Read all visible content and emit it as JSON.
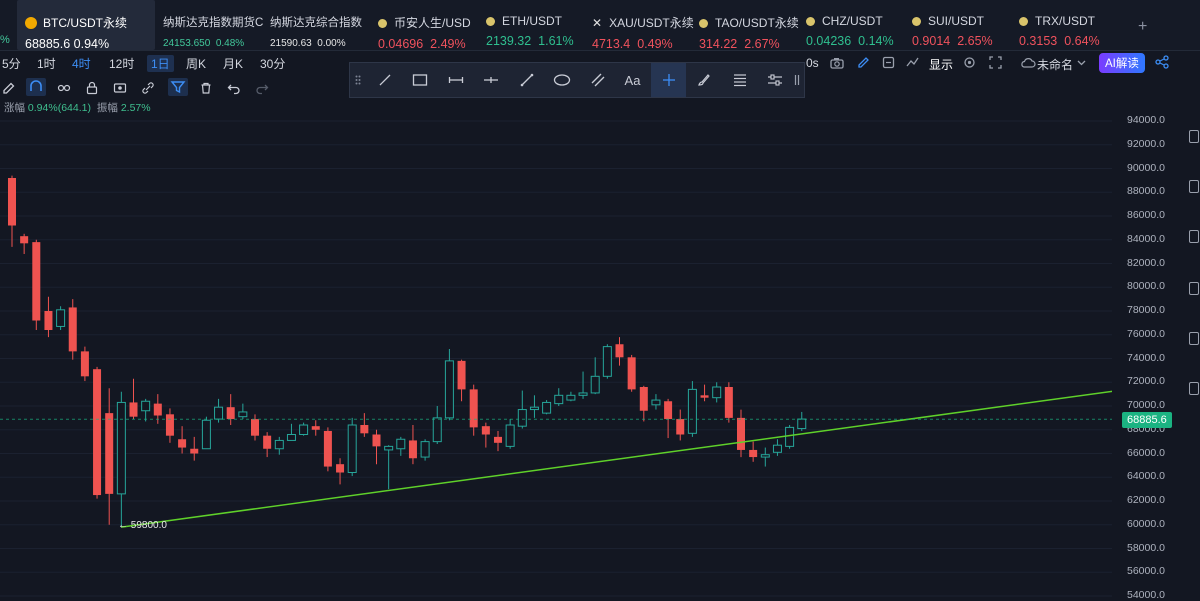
{
  "tickers": [
    {
      "name": "BTC/USDT永续",
      "price": "68885.6",
      "change": "0.94%",
      "color": "#ffffff"
    },
    {
      "name": "纳斯达克指数期货C",
      "price": "24153.650",
      "change": "0.48%",
      "color": "#42c89b"
    },
    {
      "name": "纳斯达克综合指数",
      "price": "21590.63",
      "change": "0.00%",
      "color": "#ffffff"
    },
    {
      "name": "币安人生/USD",
      "price": "0.04696",
      "change": "2.49%",
      "color": "#f0525d"
    },
    {
      "name": "ETH/USDT",
      "price": "2139.32",
      "change": "1.61%",
      "color": "#2fbf8f"
    },
    {
      "name": "XAU/USDT永续",
      "price": "4713.4",
      "change": "0.49%",
      "color": "#f0525d"
    },
    {
      "name": "TAO/USDT永续",
      "price": "314.22",
      "change": "2.67%",
      "color": "#f0525d"
    },
    {
      "name": "CHZ/USDT",
      "price": "0.04236",
      "change": "0.14%",
      "color": "#2fbf8f"
    },
    {
      "name": "SUI/USDT",
      "price": "0.9014",
      "change": "2.65%",
      "color": "#f0525d"
    },
    {
      "name": "TRX/USDT",
      "price": "0.3153",
      "change": "0.64%",
      "color": "#f0525d"
    }
  ],
  "left_edge_marker": "%",
  "add_symbol": "+",
  "intervals": [
    "5分",
    "1时",
    "4时",
    "12时",
    "1日",
    "周K",
    "月K",
    "30分"
  ],
  "active_interval": "4时",
  "selected_interval": "1日",
  "right_toolbar": {
    "interval_fragment": "0s",
    "display_label": "显示",
    "layout_name": "未命名",
    "ai_button": "AI解读"
  },
  "change_info": {
    "change_label": "涨幅",
    "change_value": "0.94%(644.1)",
    "amplitude_label": "振幅",
    "amplitude_value": "2.57%"
  },
  "draw_tools": [
    "cursor",
    "line",
    "rectangle",
    "horizontal-ray",
    "horizontal-line",
    "trend-line",
    "ellipse",
    "parallel-channel",
    "text",
    "crosshair",
    "brush",
    "fib",
    "settings"
  ],
  "price_axis": [
    "94000.0",
    "92000.0",
    "90000.0",
    "88000.0",
    "86000.0",
    "84000.0",
    "82000.0",
    "80000.0",
    "78000.0",
    "76000.0",
    "74000.0",
    "72000.0",
    "70000.0",
    "68000.0",
    "66000.0",
    "64000.0",
    "62000.0",
    "60000.0",
    "58000.0",
    "56000.0",
    "54000.0"
  ],
  "last_price": "68885.6",
  "low_label": "← 59800.0",
  "colors": {
    "up": "#26a69a",
    "down": "#ef5350",
    "trendline": "#5fd12a",
    "background": "#131722",
    "last_price_tag": "#1bb382"
  },
  "chart_data": {
    "type": "candlestick",
    "ylim": [
      54000,
      95500
    ],
    "last_price": 68885.6,
    "low": 59800.0,
    "trendline": {
      "from": 59800,
      "to": 71300
    },
    "candles": [
      {
        "o": 89200,
        "h": 89400,
        "c": 85200,
        "l": 83400
      },
      {
        "o": 84300,
        "h": 84500,
        "c": 83700,
        "l": 82800
      },
      {
        "o": 83800,
        "h": 84000,
        "c": 77200,
        "l": 76400
      },
      {
        "o": 78000,
        "h": 79200,
        "c": 76400,
        "l": 75800
      },
      {
        "o": 76700,
        "h": 78400,
        "c": 78100,
        "l": 76400
      },
      {
        "o": 78300,
        "h": 79000,
        "c": 74600,
        "l": 73900
      },
      {
        "o": 74600,
        "h": 75000,
        "c": 72500,
        "l": 72100
      },
      {
        "o": 73100,
        "h": 73300,
        "c": 62500,
        "l": 62200
      },
      {
        "o": 69400,
        "h": 71500,
        "c": 62600,
        "l": 60000
      },
      {
        "o": 62600,
        "h": 71200,
        "c": 70300,
        "l": 59800
      },
      {
        "o": 70300,
        "h": 72300,
        "c": 69100,
        "l": 68900
      },
      {
        "o": 69600,
        "h": 70600,
        "c": 70400,
        "l": 68700
      },
      {
        "o": 70200,
        "h": 71000,
        "c": 69200,
        "l": 68500
      },
      {
        "o": 69300,
        "h": 69800,
        "c": 67500,
        "l": 66900
      },
      {
        "o": 67200,
        "h": 68300,
        "c": 66500,
        "l": 66000
      },
      {
        "o": 66400,
        "h": 67400,
        "c": 66000,
        "l": 65400
      },
      {
        "o": 66400,
        "h": 69100,
        "c": 68800,
        "l": 66400
      },
      {
        "o": 68900,
        "h": 70600,
        "c": 69900,
        "l": 68600
      },
      {
        "o": 69900,
        "h": 71000,
        "c": 68900,
        "l": 68400
      },
      {
        "o": 69100,
        "h": 70200,
        "c": 69500,
        "l": 68900
      },
      {
        "o": 68900,
        "h": 69300,
        "c": 67500,
        "l": 67100
      },
      {
        "o": 67500,
        "h": 67800,
        "c": 66400,
        "l": 65700
      },
      {
        "o": 66400,
        "h": 67400,
        "c": 67100,
        "l": 65900
      },
      {
        "o": 67100,
        "h": 68500,
        "c": 67600,
        "l": 67100
      },
      {
        "o": 67600,
        "h": 68600,
        "c": 68400,
        "l": 67500
      },
      {
        "o": 68300,
        "h": 68800,
        "c": 68000,
        "l": 67500
      },
      {
        "o": 67900,
        "h": 68200,
        "c": 64900,
        "l": 64500
      },
      {
        "o": 65100,
        "h": 65600,
        "c": 64400,
        "l": 63400
      },
      {
        "o": 64400,
        "h": 69000,
        "c": 68400,
        "l": 64100
      },
      {
        "o": 68400,
        "h": 69400,
        "c": 67700,
        "l": 67400
      },
      {
        "o": 67600,
        "h": 68000,
        "c": 66600,
        "l": 65100
      },
      {
        "o": 66300,
        "h": 66700,
        "c": 66600,
        "l": 63000
      },
      {
        "o": 66400,
        "h": 67400,
        "c": 67200,
        "l": 65800
      },
      {
        "o": 67100,
        "h": 68400,
        "c": 65600,
        "l": 65100
      },
      {
        "o": 65700,
        "h": 67200,
        "c": 67000,
        "l": 65400
      },
      {
        "o": 67000,
        "h": 70000,
        "c": 69000,
        "l": 66800
      },
      {
        "o": 69000,
        "h": 74800,
        "c": 73800,
        "l": 68800
      },
      {
        "o": 73800,
        "h": 73900,
        "c": 71400,
        "l": 70400
      },
      {
        "o": 71400,
        "h": 71800,
        "c": 68200,
        "l": 67500
      },
      {
        "o": 68300,
        "h": 68600,
        "c": 67600,
        "l": 66500
      },
      {
        "o": 67400,
        "h": 67900,
        "c": 66900,
        "l": 66200
      },
      {
        "o": 66600,
        "h": 68900,
        "c": 68400,
        "l": 66400
      },
      {
        "o": 68300,
        "h": 71300,
        "c": 69700,
        "l": 68100
      },
      {
        "o": 69700,
        "h": 70900,
        "c": 69900,
        "l": 69000
      },
      {
        "o": 69400,
        "h": 70500,
        "c": 70300,
        "l": 69300
      },
      {
        "o": 70200,
        "h": 71500,
        "c": 70900,
        "l": 70000
      },
      {
        "o": 70500,
        "h": 71200,
        "c": 70900,
        "l": 70400
      },
      {
        "o": 70900,
        "h": 72900,
        "c": 71100,
        "l": 70600
      },
      {
        "o": 71100,
        "h": 74100,
        "c": 72500,
        "l": 71000
      },
      {
        "o": 72500,
        "h": 75200,
        "c": 75000,
        "l": 72300
      },
      {
        "o": 75200,
        "h": 75800,
        "c": 74100,
        "l": 73400
      },
      {
        "o": 74100,
        "h": 74300,
        "c": 71400,
        "l": 71200
      },
      {
        "o": 71600,
        "h": 71700,
        "c": 69600,
        "l": 68700
      },
      {
        "o": 70100,
        "h": 71000,
        "c": 70500,
        "l": 69700
      },
      {
        "o": 70400,
        "h": 70600,
        "c": 68900,
        "l": 67300
      },
      {
        "o": 68900,
        "h": 69700,
        "c": 67600,
        "l": 67100
      },
      {
        "o": 67700,
        "h": 72100,
        "c": 71400,
        "l": 67400
      },
      {
        "o": 70900,
        "h": 71800,
        "c": 70700,
        "l": 70400
      },
      {
        "o": 70700,
        "h": 72000,
        "c": 71600,
        "l": 70300
      },
      {
        "o": 71600,
        "h": 72000,
        "c": 69000,
        "l": 68600
      },
      {
        "o": 69000,
        "h": 69700,
        "c": 66300,
        "l": 65700
      },
      {
        "o": 66300,
        "h": 67000,
        "c": 65700,
        "l": 65300
      },
      {
        "o": 65700,
        "h": 66500,
        "c": 65900,
        "l": 64900
      },
      {
        "o": 66100,
        "h": 67200,
        "c": 66700,
        "l": 65800
      },
      {
        "o": 66600,
        "h": 68400,
        "c": 68200,
        "l": 66400
      },
      {
        "o": 68100,
        "h": 69500,
        "c": 68900,
        "l": 67900
      }
    ]
  }
}
